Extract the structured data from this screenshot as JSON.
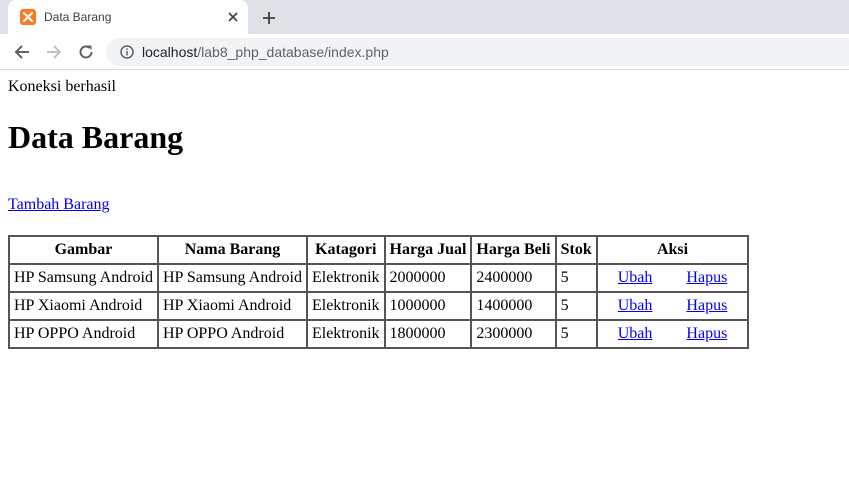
{
  "browser": {
    "tab_title": "Data Barang",
    "url_host": "localhost",
    "url_path": "/lab8_php_database/index.php"
  },
  "page": {
    "status": "Koneksi berhasil",
    "title": "Data Barang",
    "add_link": "Tambah Barang"
  },
  "table": {
    "headers": [
      "Gambar",
      "Nama Barang",
      "Katagori",
      "Harga Jual",
      "Harga Beli",
      "Stok",
      "Aksi"
    ],
    "rows": [
      {
        "gambar_alt": "HP Samsung Android",
        "nama": "HP Samsung Android",
        "kategori": "Elektronik",
        "harga_jual": "2000000",
        "harga_beli": "2400000",
        "stok": "5",
        "edit": "Ubah",
        "delete": "Hapus"
      },
      {
        "gambar_alt": "HP Xiaomi Android",
        "nama": "HP Xiaomi Android",
        "kategori": "Elektronik",
        "harga_jual": "1000000",
        "harga_beli": "1400000",
        "stok": "5",
        "edit": "Ubah",
        "delete": "Hapus"
      },
      {
        "gambar_alt": "HP OPPO Android",
        "nama": "HP OPPO Android",
        "kategori": "Elektronik",
        "harga_jual": "1800000",
        "harga_beli": "2300000",
        "stok": "5",
        "edit": "Ubah",
        "delete": "Hapus"
      }
    ]
  },
  "icons": {
    "favicon": "xampp-icon",
    "tab_close": "close-icon",
    "new_tab": "plus-icon",
    "back": "arrow-left-icon",
    "forward": "arrow-right-icon",
    "reload": "reload-icon",
    "site_info": "info-icon"
  },
  "colors": {
    "favicon": "#fb7a24",
    "link": "#0000ee",
    "tabstrip": "#dee1e6",
    "omnibox": "#f1f3f4"
  }
}
